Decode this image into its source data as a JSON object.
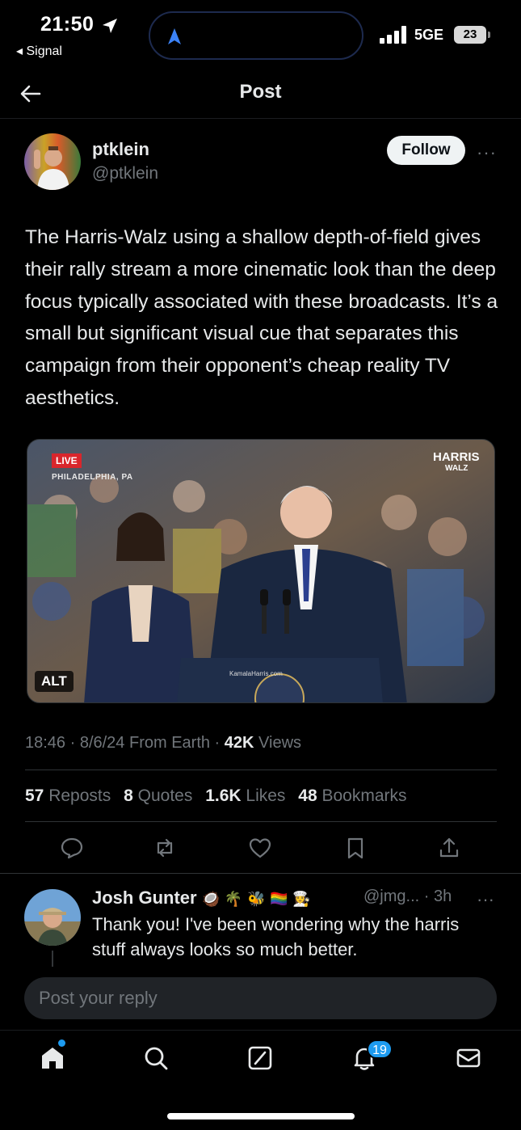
{
  "status_bar": {
    "time": "21:50",
    "back_app": "◂ Signal",
    "network": "5GE",
    "battery": "23"
  },
  "header": {
    "title": "Post"
  },
  "post": {
    "author_name": "ptklein",
    "author_handle": "@ptklein",
    "follow_label": "Follow",
    "text": "The Harris-Walz using a shallow depth-of-field gives their rally stream a more cinematic look than the deep focus typically associated with these broadcasts. It’s a small but significant visual cue that separates this campaign from their opponent’s cheap reality TV aesthetics.",
    "media": {
      "live_label": "LIVE",
      "location": "PHILADELPHIA, PA",
      "logo_top": "HARRIS",
      "logo_bottom": "WALZ",
      "podium_text": "KamalaHarris.com",
      "alt_label": "ALT"
    },
    "meta": {
      "time_date": "18:46 · 8/6/24 From Earth · ",
      "views_count": "42K",
      "views_label": " Views"
    },
    "stats": {
      "reposts_count": "57",
      "reposts_label": "Reposts",
      "quotes_count": "8",
      "quotes_label": "Quotes",
      "likes_count": "1.6K",
      "likes_label": "Likes",
      "bookmarks_count": "48",
      "bookmarks_label": "Bookmarks"
    }
  },
  "reply": {
    "name": "Josh Gunter",
    "emojis": "🥥 🌴 🐝 🏳️‍🌈 👩‍🍳",
    "handle": "@jmg... · 3h",
    "text": "Thank you! I've been wondering why the harris stuff always looks so much better."
  },
  "composer": {
    "placeholder": "Post your reply"
  },
  "nav": {
    "notification_count": "19"
  },
  "colors": {
    "accent": "#1d9bf0",
    "text_primary": "#e7e9ea",
    "text_secondary": "#71767b",
    "background": "#000000"
  }
}
